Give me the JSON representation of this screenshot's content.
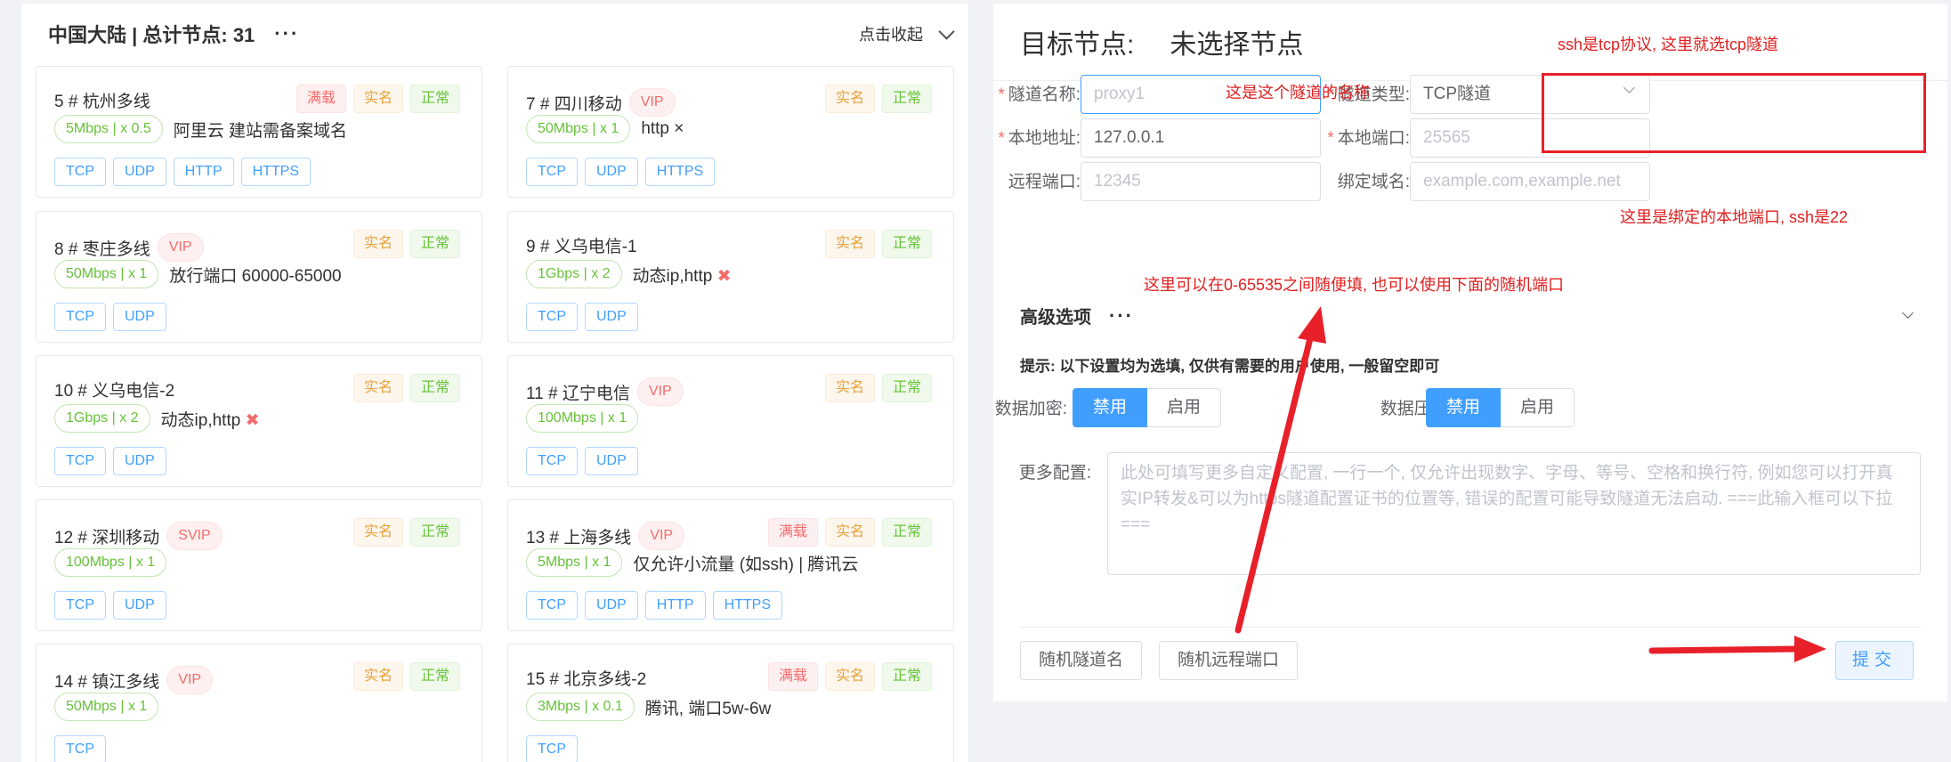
{
  "left_panel": {
    "title": "中国大陆 | 总计节点: 31",
    "more": "···",
    "collapse": "点击收起"
  },
  "nodes": [
    {
      "name": "5 # 杭州多线",
      "level": "",
      "tags": [
        "满载",
        "实名",
        "正常"
      ],
      "bandwidth": "5Mbps | x 0.5",
      "note": "阿里云 建站需备案域名",
      "note_x": false,
      "protocols": [
        "TCP",
        "UDP",
        "HTTP",
        "HTTPS"
      ]
    },
    {
      "name": "7 # 四川移动",
      "level": "VIP",
      "tags": [
        "实名",
        "正常"
      ],
      "bandwidth": "50Mbps | x 1",
      "note": "http ×",
      "note_x": false,
      "protocols": [
        "TCP",
        "UDP",
        "HTTPS"
      ]
    },
    {
      "name": "8 # 枣庄多线",
      "level": "VIP",
      "tags": [
        "实名",
        "正常"
      ],
      "bandwidth": "50Mbps | x 1",
      "note": "放行端口 60000-65000",
      "note_x": false,
      "protocols": [
        "TCP",
        "UDP"
      ]
    },
    {
      "name": "9 # 义乌电信-1",
      "level": "",
      "tags": [
        "实名",
        "正常"
      ],
      "bandwidth": "1Gbps | x 2",
      "note": "动态ip,http",
      "note_x": true,
      "protocols": [
        "TCP",
        "UDP"
      ]
    },
    {
      "name": "10 # 义乌电信-2",
      "level": "",
      "tags": [
        "实名",
        "正常"
      ],
      "bandwidth": "1Gbps | x 2",
      "note": "动态ip,http",
      "note_x": true,
      "protocols": [
        "TCP",
        "UDP"
      ]
    },
    {
      "name": "11 # 辽宁电信",
      "level": "VIP",
      "tags": [
        "实名",
        "正常"
      ],
      "bandwidth": "100Mbps | x 1",
      "note": "",
      "note_x": false,
      "protocols": [
        "TCP",
        "UDP"
      ]
    },
    {
      "name": "12 # 深圳移动",
      "level": "SVIP",
      "tags": [
        "实名",
        "正常"
      ],
      "bandwidth": "100Mbps | x 1",
      "note": "",
      "note_x": false,
      "protocols": [
        "TCP",
        "UDP"
      ]
    },
    {
      "name": "13 # 上海多线",
      "level": "VIP",
      "tags": [
        "满载",
        "实名",
        "正常"
      ],
      "bandwidth": "5Mbps | x 1",
      "note": "仅允许小流量 (如ssh) | 腾讯云",
      "note_x": false,
      "protocols": [
        "TCP",
        "UDP",
        "HTTP",
        "HTTPS"
      ]
    },
    {
      "name": "14 # 镇江多线",
      "level": "VIP",
      "tags": [
        "实名",
        "正常"
      ],
      "bandwidth": "50Mbps | x 1",
      "note": "",
      "note_x": false,
      "protocols": [
        "TCP"
      ]
    },
    {
      "name": "15 # 北京多线-2",
      "level": "",
      "tags": [
        "满载",
        "实名",
        "正常"
      ],
      "bandwidth": "3Mbps | x 0.1",
      "note": "腾讯, 端口5w-6w",
      "note_x": false,
      "protocols": [
        "TCP"
      ]
    }
  ],
  "form": {
    "target_label": "目标节点:",
    "target_value": "未选择节点",
    "tunnel_name_label": "隧道名称:",
    "tunnel_name_placeholder": "proxy1",
    "tunnel_type_label": "隧道类型:",
    "tunnel_type_value": "TCP隧道",
    "local_addr_label": "本地地址:",
    "local_addr_value": "127.0.0.1",
    "local_port_label": "本地端口:",
    "local_port_placeholder": "25565",
    "remote_port_label": "远程端口:",
    "remote_port_placeholder": "12345",
    "domain_label": "绑定域名:",
    "domain_placeholder": "example.com,example.net",
    "advanced_title": "高级选项",
    "advanced_more": "···",
    "hint": "提示: 以下设置均为选填, 仅供有需要的用户使用, 一般留空即可",
    "encrypt_label": "数据加密:",
    "compress_label": "数据压缩:",
    "toggle_on": "禁用",
    "toggle_off": "启用",
    "more_config_label": "更多配置:",
    "more_config_placeholder": "此处可填写更多自定义配置, 一行一个, 仅允许出现数字、字母、等号、空格和换行符, 例如您可以打开真实IP转发&可以为https隧道配置证书的位置等, 错误的配置可能导致隧道无法启动. ===此输入框可以下拉===",
    "random_name_button": "随机隧道名",
    "random_port_button": "随机远程端口",
    "submit_button": "提交"
  },
  "annotations": {
    "tcp_note": "ssh是tcp协议, 这里就选tcp隧道",
    "name_note": "这是这个隧道的名称",
    "local_port_note": "这里是绑定的本地端口, ssh是22",
    "remote_port_note": "这里可以在0-65535之间随便填, 也可以使用下面的随机端口"
  },
  "colors": {
    "primary": "#409eff",
    "danger": "#f56c6c",
    "warning": "#e6a23c",
    "success": "#67c23a",
    "annotation": "#e8202a"
  }
}
